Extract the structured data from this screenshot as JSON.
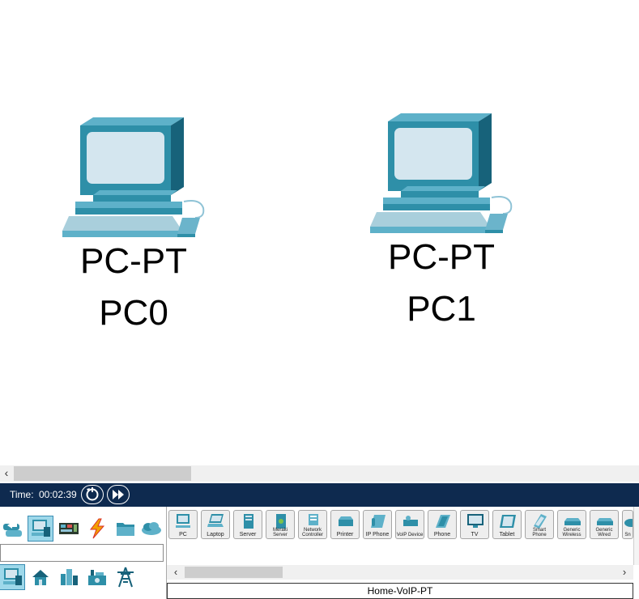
{
  "workspace": {
    "devices": [
      {
        "model": "PC-PT",
        "name": "PC0"
      },
      {
        "model": "PC-PT",
        "name": "PC1"
      }
    ]
  },
  "timebar": {
    "time_label": "Time:",
    "time_value": "00:02:39",
    "icons": [
      "power-cycle-icon",
      "fast-forward-icon"
    ]
  },
  "palette": {
    "categories": [
      {
        "icon": "network-devices-icon",
        "selected": false
      },
      {
        "icon": "end-devices-icon",
        "selected": true
      },
      {
        "icon": "components-icon",
        "selected": false
      },
      {
        "icon": "connections-icon",
        "selected": false
      },
      {
        "icon": "miscellaneous-icon",
        "selected": false
      },
      {
        "icon": "multiuser-cloud-icon",
        "selected": false
      }
    ],
    "subcategories": [
      {
        "icon": "end-devices-sub-icon",
        "selected": true
      },
      {
        "icon": "home-icon",
        "selected": false
      },
      {
        "icon": "smart-city-icon",
        "selected": false
      },
      {
        "icon": "industrial-icon",
        "selected": false
      },
      {
        "icon": "power-grid-icon",
        "selected": false
      }
    ]
  },
  "device_list": {
    "items": [
      {
        "label": "PC",
        "icon": "pc-icon"
      },
      {
        "label": "Laptop",
        "icon": "laptop-icon"
      },
      {
        "label": "Server",
        "icon": "server-icon"
      },
      {
        "label": "Meraki Server",
        "icon": "meraki-server-icon"
      },
      {
        "label": "Network Controller",
        "icon": "network-controller-icon"
      },
      {
        "label": "Printer",
        "icon": "printer-icon"
      },
      {
        "label": "IP Phone",
        "icon": "ip-phone-icon"
      },
      {
        "label": "VoIP Device",
        "icon": "voip-device-icon"
      },
      {
        "label": "Phone",
        "icon": "phone-icon"
      },
      {
        "label": "TV",
        "icon": "tv-icon"
      },
      {
        "label": "Tablet",
        "icon": "tablet-icon"
      },
      {
        "label": "Smart Phone",
        "icon": "smart-phone-icon"
      },
      {
        "label": "Generic Wireless",
        "icon": "generic-wireless-icon"
      },
      {
        "label": "Generic Wired",
        "icon": "generic-wired-icon"
      },
      {
        "label": "Sn",
        "icon": "sniffer-icon"
      }
    ],
    "selected_name": "Home-VoIP-PT"
  },
  "colors": {
    "device_teal": "#2e8fa8",
    "device_dark": "#17627a",
    "device_screen": "#d4e6ef",
    "timebar_bg": "#0e2a4f",
    "selected_cat": "#9ed8ea"
  }
}
